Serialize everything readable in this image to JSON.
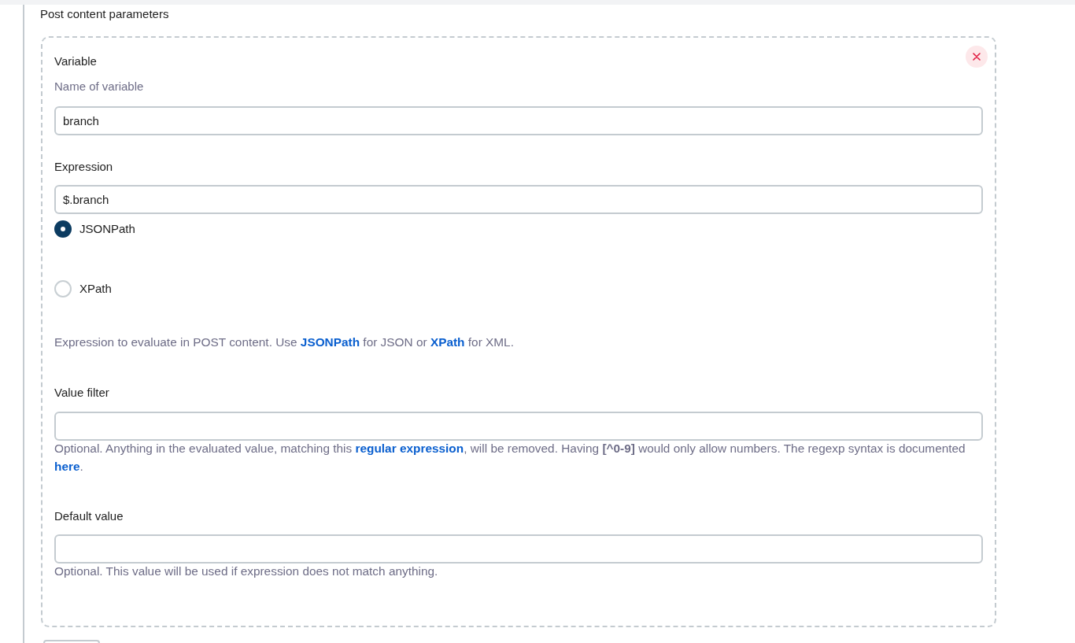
{
  "section_title": "Post content parameters",
  "variable": {
    "label": "Variable",
    "description": "Name of variable",
    "value": "branch"
  },
  "expression": {
    "label": "Expression",
    "value": "$.branch",
    "options": [
      {
        "label": "JSONPath",
        "selected": true
      },
      {
        "label": "XPath",
        "selected": false
      }
    ],
    "help": [
      {
        "kind": "text",
        "text": "Expression to evaluate in POST content. Use "
      },
      {
        "kind": "link",
        "text": "JSONPath"
      },
      {
        "kind": "text",
        "text": " for JSON or "
      },
      {
        "kind": "link",
        "text": "XPath"
      },
      {
        "kind": "text",
        "text": " for XML."
      }
    ]
  },
  "value_filter": {
    "label": "Value filter",
    "help": [
      {
        "kind": "text",
        "text": "Optional. Anything in the evaluated value, matching this "
      },
      {
        "kind": "link",
        "text": "regular expression"
      },
      {
        "kind": "text",
        "text": ", will be removed. Having **[^0-9]** would only allow numbers. The regexp syntax is documented "
      },
      {
        "kind": "link",
        "text": "here"
      },
      {
        "kind": "text",
        "text": "."
      }
    ]
  },
  "default_value": {
    "label": "Default value",
    "help": [
      {
        "kind": "text",
        "text": "Optional. This value will be used if expression does not match anything."
      }
    ]
  }
}
